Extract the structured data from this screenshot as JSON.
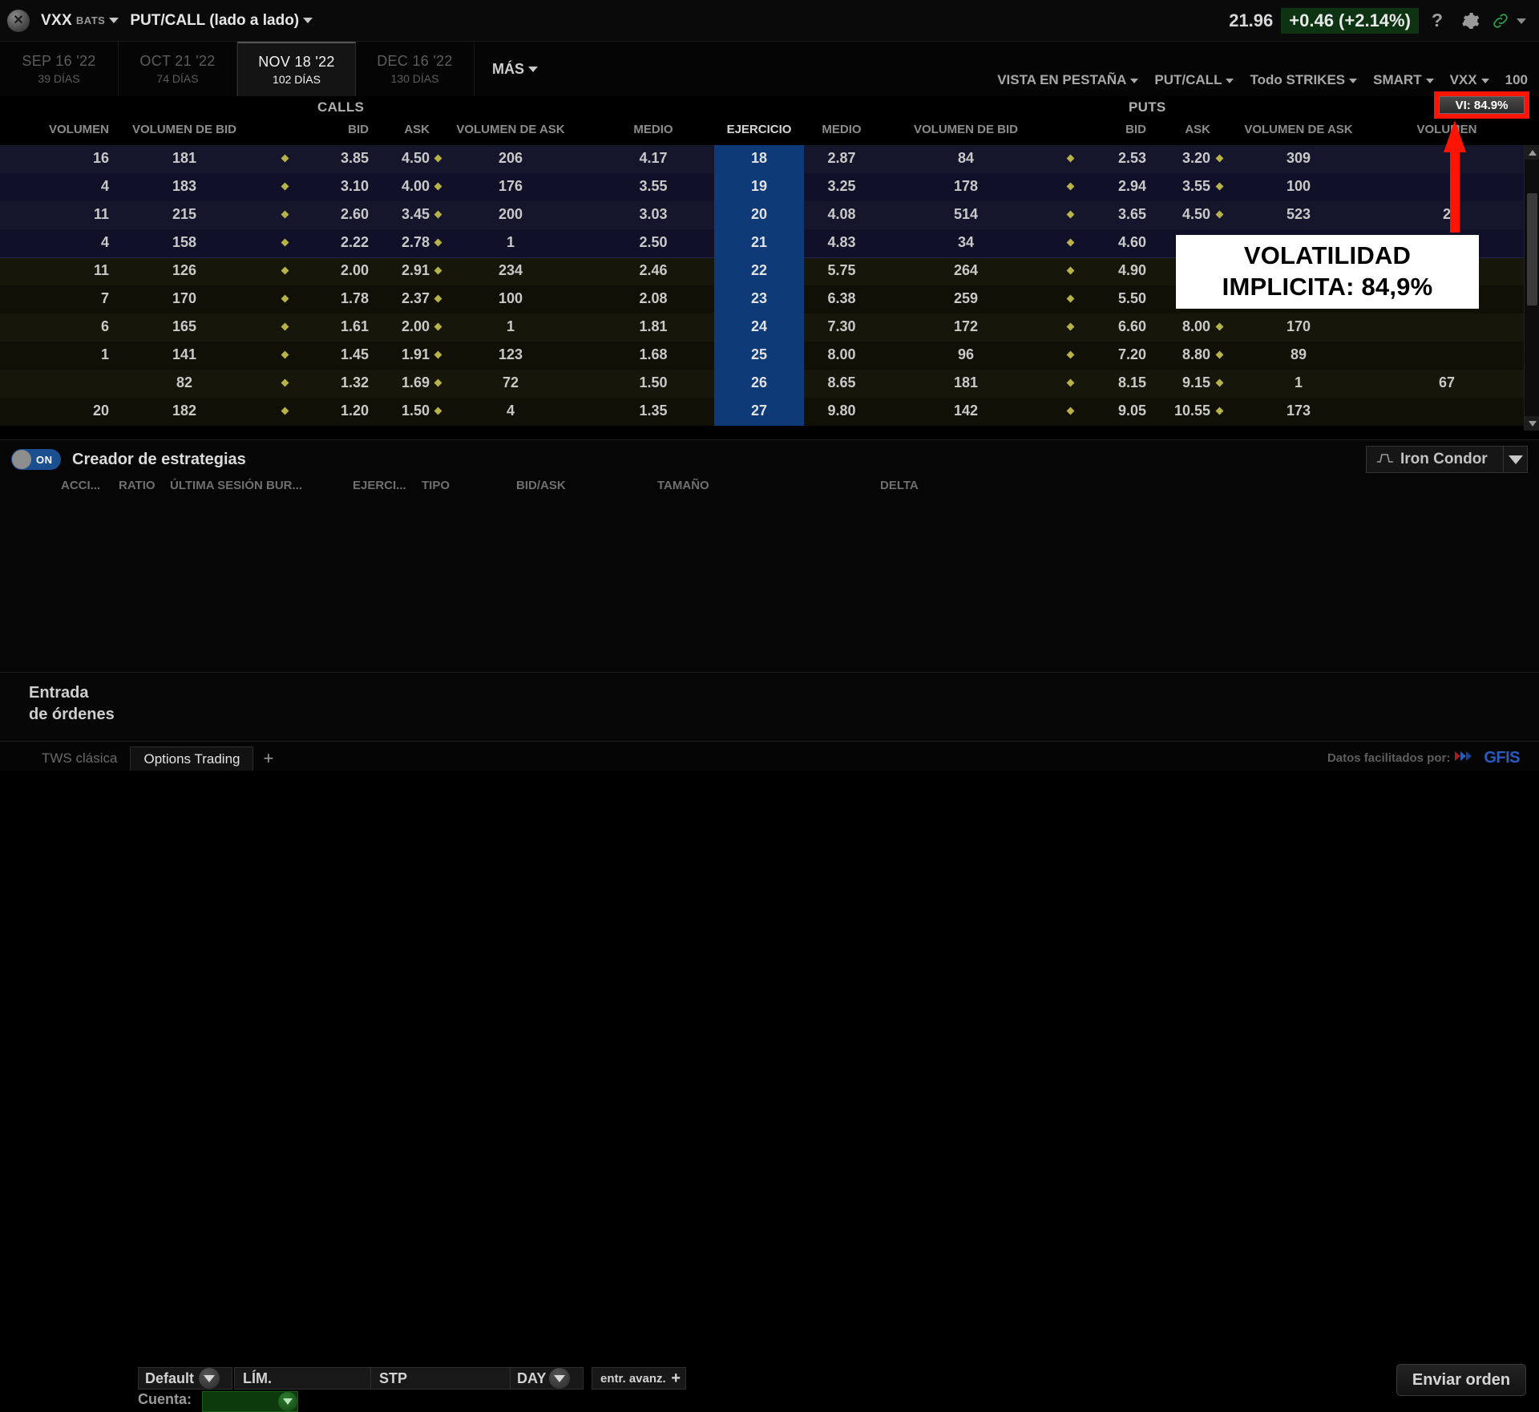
{
  "titlebar": {
    "close_icon": "close-icon",
    "symbol": "VXX",
    "exchange": "BATS",
    "mode": "PUT/CALL (lado a lado)",
    "last_price": "21.96",
    "price_change": "+0.46 (+2.14%)",
    "help_icon": "?",
    "gear_icon": "gear-icon",
    "link_icon": "link-icon",
    "accent_green": "#0d3313"
  },
  "expiries": [
    {
      "date": "SEP 16 '22",
      "days": "39 DÍAS",
      "active": false
    },
    {
      "date": "OCT 21 '22",
      "days": "74 DÍAS",
      "active": false
    },
    {
      "date": "NOV 18 '22",
      "days": "102 DÍAS",
      "active": true
    },
    {
      "date": "DEC 16 '22",
      "days": "130 DÍAS",
      "active": false
    }
  ],
  "more_tab": "MÁS",
  "chain_controls": [
    {
      "label": "VISTA EN PESTAÑA",
      "caret": true
    },
    {
      "label": "PUT/CALL",
      "caret": true
    },
    {
      "label": "Todo STRIKES",
      "caret": true
    },
    {
      "label": "SMART",
      "caret": true
    },
    {
      "label": "VXX",
      "caret": true
    },
    {
      "label": "100",
      "caret": false
    }
  ],
  "iv": {
    "badge": "VI: 84.9%",
    "callout_line1": "VOLATILIDAD",
    "callout_line2": "IMPLICITA: 84,9%",
    "highlight_color": "#fc1505"
  },
  "chain": {
    "group_calls": "CALLS",
    "group_exercise": "EJERCICIO",
    "group_puts": "PUTS",
    "call_headers": [
      "VOLUMEN",
      "VOLUMEN DE BID",
      "BID",
      "ASK",
      "VOLUMEN DE ASK",
      "MEDIO"
    ],
    "strike_header": "EJERCICIO",
    "put_headers": [
      "MEDIO",
      "VOLUMEN DE BID",
      "BID",
      "ASK",
      "VOLUMEN DE ASK",
      "VOLUMEN"
    ],
    "rows": [
      {
        "strike": "18",
        "c_vol": "16",
        "c_bidvol": "181",
        "c_bid": "3.85",
        "c_ask": "4.50",
        "c_askvol": "206",
        "c_mid": "4.17",
        "p_mid": "2.87",
        "p_bidvol": "84",
        "p_bid": "2.53",
        "p_ask": "3.20",
        "p_askvol": "309",
        "p_vol": "",
        "tint": "tint-purple"
      },
      {
        "strike": "19",
        "c_vol": "4",
        "c_bidvol": "183",
        "c_bid": "3.10",
        "c_ask": "4.00",
        "c_askvol": "176",
        "c_mid": "3.55",
        "p_mid": "3.25",
        "p_bidvol": "178",
        "p_bid": "2.94",
        "p_ask": "3.55",
        "p_askvol": "100",
        "p_vol": "",
        "tint": "tint-purple2"
      },
      {
        "strike": "20",
        "c_vol": "11",
        "c_bidvol": "215",
        "c_bid": "2.60",
        "c_ask": "3.45",
        "c_askvol": "200",
        "c_mid": "3.03",
        "p_mid": "4.08",
        "p_bidvol": "514",
        "p_bid": "3.65",
        "p_ask": "4.50",
        "p_askvol": "523",
        "p_vol": "2",
        "tint": "tint-purple"
      },
      {
        "strike": "21",
        "c_vol": "4",
        "c_bidvol": "158",
        "c_bid": "2.22",
        "c_ask": "2.78",
        "c_askvol": "1",
        "c_mid": "2.50",
        "p_mid": "4.83",
        "p_bidvol": "34",
        "p_bid": "4.60",
        "p_ask": "",
        "p_askvol": "",
        "p_vol": "",
        "tint": "tint-purple2"
      },
      {
        "strike": "22",
        "c_vol": "11",
        "c_bidvol": "126",
        "c_bid": "2.00",
        "c_ask": "2.91",
        "c_askvol": "234",
        "c_mid": "2.46",
        "p_mid": "5.75",
        "p_bidvol": "264",
        "p_bid": "4.90",
        "p_ask": "",
        "p_askvol": "",
        "p_vol": "",
        "tint": "tint-olive",
        "divider": true
      },
      {
        "strike": "23",
        "c_vol": "7",
        "c_bidvol": "170",
        "c_bid": "1.78",
        "c_ask": "2.37",
        "c_askvol": "100",
        "c_mid": "2.08",
        "p_mid": "6.38",
        "p_bidvol": "259",
        "p_bid": "5.50",
        "p_ask": "",
        "p_askvol": "",
        "p_vol": "",
        "tint": "tint-olive2"
      },
      {
        "strike": "24",
        "c_vol": "6",
        "c_bidvol": "165",
        "c_bid": "1.61",
        "c_ask": "2.00",
        "c_askvol": "1",
        "c_mid": "1.81",
        "p_mid": "7.30",
        "p_bidvol": "172",
        "p_bid": "6.60",
        "p_ask": "8.00",
        "p_askvol": "170",
        "p_vol": "",
        "tint": "tint-olive"
      },
      {
        "strike": "25",
        "c_vol": "1",
        "c_bidvol": "141",
        "c_bid": "1.45",
        "c_ask": "1.91",
        "c_askvol": "123",
        "c_mid": "1.68",
        "p_mid": "8.00",
        "p_bidvol": "96",
        "p_bid": "7.20",
        "p_ask": "8.80",
        "p_askvol": "89",
        "p_vol": "",
        "tint": "tint-olive2"
      },
      {
        "strike": "26",
        "c_vol": "",
        "c_bidvol": "82",
        "c_bid": "1.32",
        "c_ask": "1.69",
        "c_askvol": "72",
        "c_mid": "1.50",
        "p_mid": "8.65",
        "p_bidvol": "181",
        "p_bid": "8.15",
        "p_ask": "9.15",
        "p_askvol": "1",
        "p_vol": "67",
        "tint": "tint-olive"
      },
      {
        "strike": "27",
        "c_vol": "20",
        "c_bidvol": "182",
        "c_bid": "1.20",
        "c_ask": "1.50",
        "c_askvol": "4",
        "c_mid": "1.35",
        "p_mid": "9.80",
        "p_bidvol": "142",
        "p_bid": "9.05",
        "p_ask": "10.55",
        "p_askvol": "173",
        "p_vol": "",
        "tint": "tint-olive2"
      }
    ]
  },
  "strategy": {
    "toggle_state": "ON",
    "title": "Creador de estrategias",
    "preset_label": "Iron Condor",
    "preset_icon": "iron-condor-icon",
    "headers": [
      "ACCI...",
      "RATIO",
      "ÚLTIMA SESIÓN BUR...",
      "EJERCI...",
      "TIPO",
      "BID/ASK",
      "TAMAÑO",
      "DELTA"
    ]
  },
  "order": {
    "label_line1": "Entrada",
    "label_line2": "de órdenes",
    "preset": "Default",
    "limit_placeholder": "LÍM.",
    "limit_value": "",
    "stop_placeholder": "STP",
    "stop_value": "",
    "tif": "DAY",
    "advanced": "entr. avanz.",
    "account_label": "Cuenta:",
    "account_value": "",
    "submit_label": "Enviar orden"
  },
  "footer": {
    "tabs": [
      {
        "label": "TWS clásica",
        "active": false
      },
      {
        "label": "Options Trading",
        "active": true
      }
    ],
    "add_tab": "+",
    "credit": "Datos facilitados por:",
    "provider": "GFIS"
  }
}
